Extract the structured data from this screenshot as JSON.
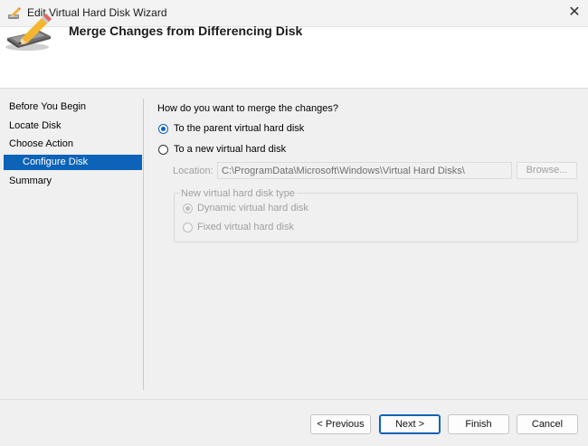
{
  "window": {
    "title": "Edit Virtual Hard Disk Wizard",
    "close_glyph": "✕",
    "icon": "pencil-disk-icon"
  },
  "header": {
    "title": "Merge Changes from Differencing Disk",
    "icon": "pencil-disk-icon"
  },
  "nav": {
    "items": [
      {
        "label": "Before You Begin"
      },
      {
        "label": "Locate Disk"
      },
      {
        "label": "Choose Action"
      },
      {
        "label": "Configure Disk",
        "selected": true
      },
      {
        "label": "Summary"
      }
    ]
  },
  "content": {
    "question": "How do you want to merge the changes?",
    "option_parent": {
      "label": "To the parent virtual hard disk",
      "checked": true
    },
    "option_new": {
      "label": "To a new virtual hard disk",
      "checked": false
    },
    "location": {
      "label": "Location:",
      "value": "C:\\ProgramData\\Microsoft\\Windows\\Virtual Hard Disks\\",
      "browse_label": "Browse..."
    },
    "disk_type": {
      "legend": "New virtual hard disk type",
      "dynamic": {
        "label": "Dynamic virtual hard disk",
        "checked": true
      },
      "fixed": {
        "label": "Fixed virtual hard disk",
        "checked": false
      }
    }
  },
  "footer": {
    "previous": "< Previous",
    "next": "Next >",
    "finish": "Finish",
    "cancel": "Cancel"
  },
  "colors": {
    "accent": "#0c63b8",
    "window_bg": "#f0f0f0",
    "header_bg": "#ffffff"
  }
}
